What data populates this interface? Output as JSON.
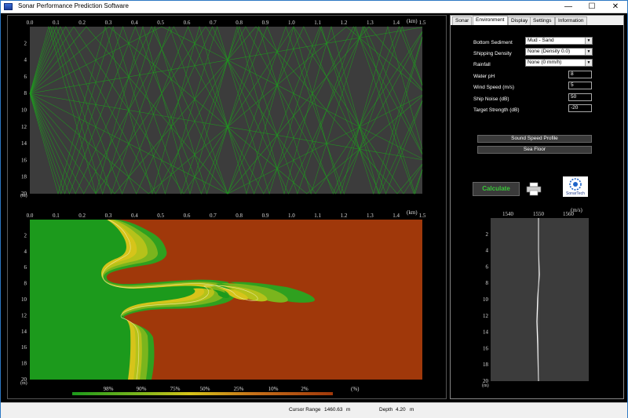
{
  "window": {
    "title": "Sonar Performance Prediction Software",
    "min": "—",
    "max": "☐",
    "close": "✕"
  },
  "ray_plot": {
    "x_unit": "(km)",
    "y_unit": "(m)",
    "x_ticks": [
      "0.0",
      "0.1",
      "0.2",
      "0.3",
      "0.4",
      "0.5",
      "0.6",
      "0.7",
      "0.8",
      "0.9",
      "1.0",
      "1.1",
      "1.2",
      "1.3",
      "1.4",
      "1.5"
    ],
    "y_ticks": [
      "2",
      "4",
      "6",
      "8",
      "10",
      "12",
      "14",
      "16",
      "18",
      "20"
    ],
    "x_range_km": [
      0,
      1.5
    ],
    "y_range_m": [
      0,
      20
    ],
    "source_depth_m": 8,
    "ray_color": "#1f9a1f",
    "bg_color": "#3c3c3c"
  },
  "detection_plot": {
    "x_unit": "(km)",
    "y_unit": "(m)",
    "x_ticks": [
      "0.0",
      "0.1",
      "0.2",
      "0.3",
      "0.4",
      "0.5",
      "0.6",
      "0.7",
      "0.8",
      "0.9",
      "1.0",
      "1.1",
      "1.2",
      "1.3",
      "1.4",
      "1.5"
    ],
    "y_ticks": [
      "2",
      "4",
      "6",
      "8",
      "10",
      "12",
      "14",
      "16",
      "18",
      "20"
    ],
    "colors": {
      "high": "#1c9a1c",
      "low": "#a0380a"
    },
    "legend": {
      "labels": [
        "98%",
        "90%",
        "75%",
        "50%",
        "25%",
        "10%",
        "2%"
      ],
      "unit": "(%)"
    }
  },
  "tabs": [
    "Sonar",
    "Environment",
    "Display",
    "Settings",
    "Information"
  ],
  "active_tab": "Environment",
  "environment": {
    "bottom_sediment": {
      "label": "Bottom Sediment",
      "value": "Mud - Sand"
    },
    "shipping_density": {
      "label": "Shipping Density",
      "value": "None (Density 0.0)"
    },
    "rainfall": {
      "label": "Rainfall",
      "value": "None (0 mm/h)"
    },
    "water_ph": {
      "label": "Water pH",
      "value": "8"
    },
    "wind_speed": {
      "label": "Wind Speed (m/s)",
      "value": "5"
    },
    "ship_noise": {
      "label": "Ship Noise (dB)",
      "value": "50"
    },
    "target_strength": {
      "label": "Target Strength (dB)",
      "value": "-20"
    },
    "sound_speed_profile_button": "Sound Speed Profile",
    "sea_floor_button": "Sea Floor",
    "calculate_button": "Calculate",
    "logo_text": "SonarTech"
  },
  "ssp_plot": {
    "x_unit": "(m/s)",
    "y_unit": "(m)",
    "x_ticks": [
      "1540",
      "1550",
      "1560"
    ],
    "y_ticks": [
      "2",
      "4",
      "6",
      "8",
      "10",
      "12",
      "14",
      "16",
      "18",
      "20"
    ]
  },
  "status": {
    "cursor_range_label": "Cursor Range",
    "cursor_range_value": "1460.63",
    "cursor_range_unit": "m",
    "depth_label": "Depth",
    "depth_value": "4.20",
    "depth_unit": "m"
  }
}
